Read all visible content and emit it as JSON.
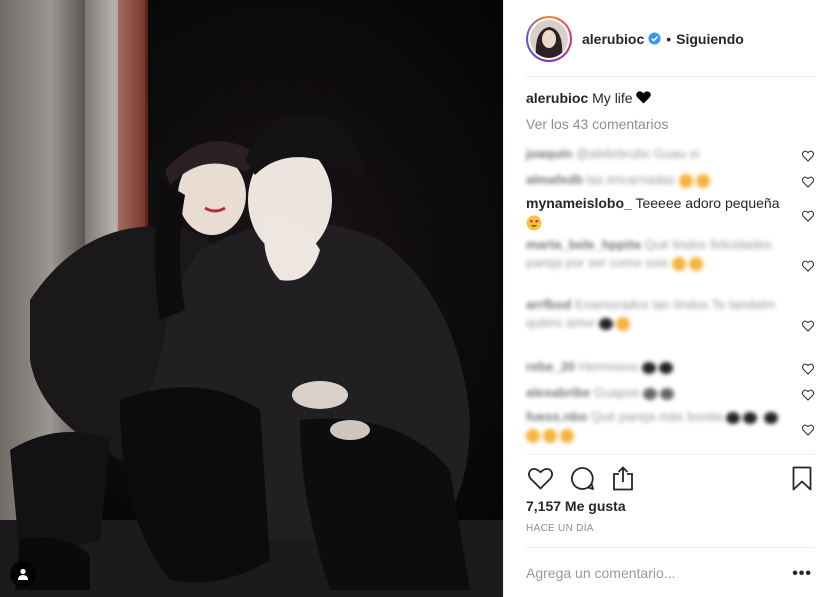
{
  "post": {
    "username": "alerubioc",
    "separator": "•",
    "follow_status": "Siguiendo"
  },
  "caption": {
    "username": "alerubioc",
    "text": "My life"
  },
  "view_all_comments": "Ver los 43 comentarios",
  "comments": [
    {
      "user": "joaquín",
      "text": "@alebrbrubc Guau sí",
      "blurred": true
    },
    {
      "user": "almafedb",
      "text": "las encarnadas",
      "blurred": true
    },
    {
      "user": "mynameislobo_",
      "text": "Teeeee adoro pequeña",
      "blurred": false
    },
    {
      "user": "marta_bele_hppita",
      "text": "Qué lindos felicidades pareja por ser como sois",
      "blurred": true
    },
    {
      "user": "arrfbod",
      "text": "Enamorados tan lindos Te también quiero amor",
      "blurred": true
    },
    {
      "user": "rebe_20",
      "text": "Hermosos",
      "blurred": true
    },
    {
      "user": "alexabribe",
      "text": "Guapos",
      "blurred": true
    },
    {
      "user": "fuess.nbo",
      "text": "Qué pareja más bonita",
      "blurred": true
    }
  ],
  "likes": "7,157 Me gusta",
  "date": "HACE UN DÍA",
  "add_comment_placeholder": "Agrega un comentario...",
  "more_options": "•••",
  "colors": {
    "verified_blue": "#3897f0",
    "text": "#262626",
    "muted": "#8e8e8e",
    "divider": "#efefef"
  },
  "icons": [
    "user-tag-icon",
    "verified-icon",
    "black-heart-icon",
    "heart-eyes-emoji-icon",
    "like-heart-icon",
    "comment-icon",
    "share-icon",
    "bookmark-icon",
    "small-heart-icon",
    "more-dots-icon"
  ]
}
